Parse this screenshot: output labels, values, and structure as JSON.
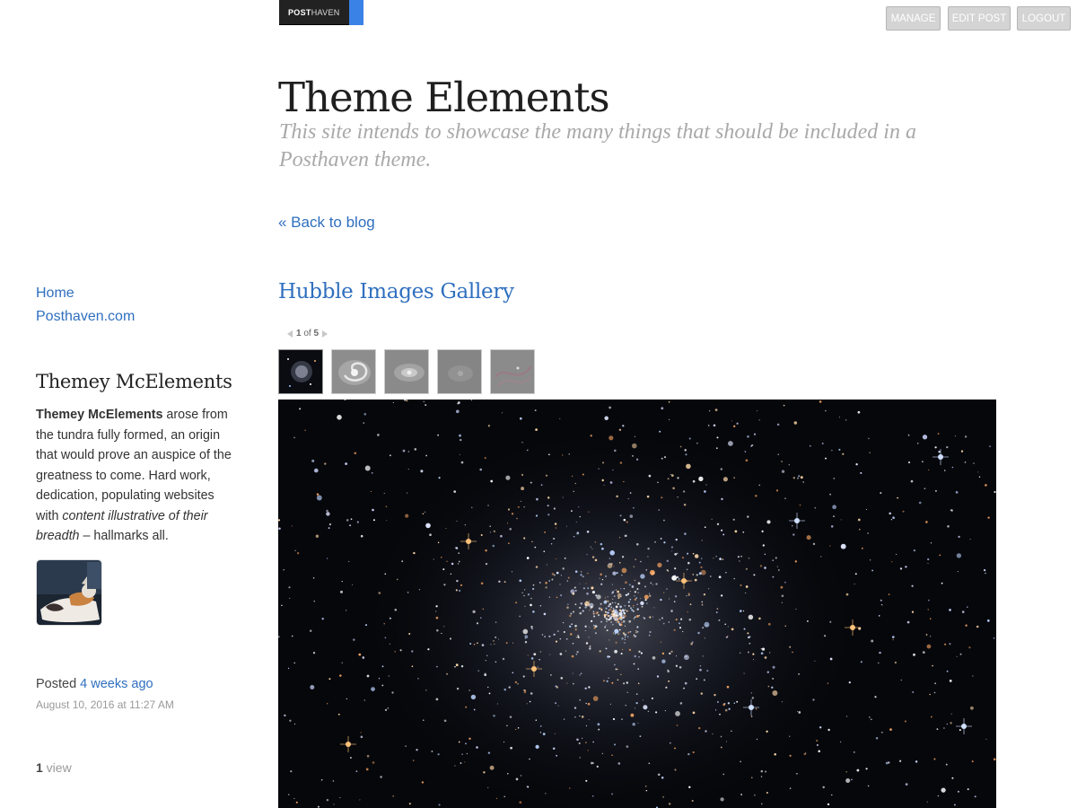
{
  "admin_bar": {
    "brand_bold": "POST",
    "brand_rest": "HAVEN",
    "buttons": {
      "manage": "MANAGE",
      "edit_post": "EDIT POST",
      "logout": "LOGOUT"
    }
  },
  "site": {
    "title": "Theme Elements",
    "description": "This site intends to showcase the many things that should be included in a Posthaven theme."
  },
  "back_link": "« Back to blog",
  "sidebar": {
    "nav": [
      "Home",
      "Posthaven.com"
    ],
    "author": {
      "name": "Themey McElements",
      "bio_bold": "Themey McElements",
      "bio_text": " arose from the tundra fully formed, an origin that would prove an auspice of the greatness to come. Hard work, dedication, populating websites with ",
      "bio_italic": "content illustrative of their breadth",
      "bio_end": " – hallmarks all."
    },
    "posted_label": "Posted ",
    "posted_relative": "4 weeks ago",
    "posted_date": "August 10, 2016 at 11:27 AM",
    "views_count": "1",
    "views_label": " view"
  },
  "post": {
    "title": "Hubble Images Gallery",
    "gallery": {
      "current": "1",
      "of_label": " of ",
      "total": "5",
      "thumbnails": [
        "star-cluster",
        "spiral-galaxy",
        "elliptical-galaxy",
        "faint-galaxy",
        "nebula"
      ]
    }
  },
  "colors": {
    "link": "#2f6fbf",
    "brand_accent": "#3b82e6",
    "muted_text": "#a9a9a9"
  }
}
